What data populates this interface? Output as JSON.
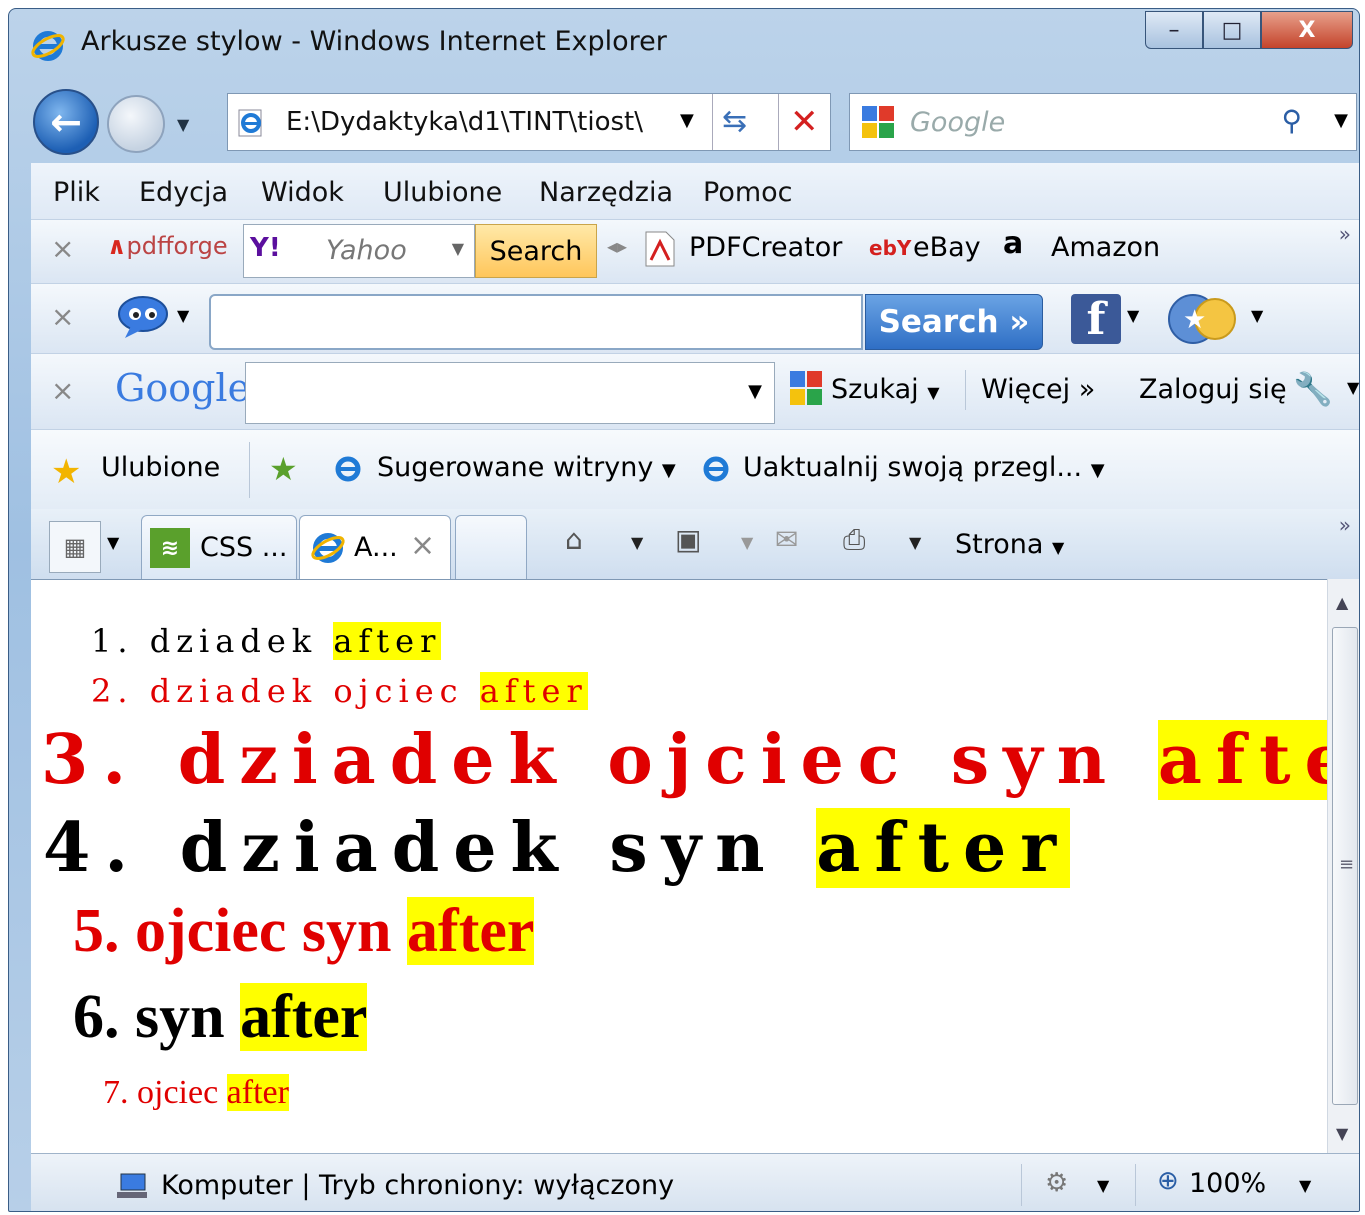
{
  "window": {
    "title": "Arkusze stylow - Windows Internet Explorer"
  },
  "caption_buttons": {
    "minimize": "–",
    "maximize": "□",
    "close": "X"
  },
  "address_bar": {
    "value": "E:\\Dydaktyka\\d1\\TINT\\tiost\\"
  },
  "search_box": {
    "placeholder": "Google"
  },
  "menu": [
    "Plik",
    "Edycja",
    "Widok",
    "Ulubione",
    "Narzędzia",
    "Pomoc"
  ],
  "toolbar1": {
    "pdfforge": "pdfforge",
    "yahoo_logo": "Y!",
    "yahoo_text": "Yahoo",
    "search_button": "Search",
    "pdfcreator": "PDFCreator",
    "ebay_icon": "ebY",
    "ebay": "eBay",
    "amazon_icon": "a",
    "amazon": "Amazon",
    "overflow": "»"
  },
  "toolbar2": {
    "search_button": "Search »",
    "facebook_icon": "f"
  },
  "toolbar3": {
    "google_logo": "Google",
    "szukaj": "Szukaj",
    "wiecej": "Więcej »",
    "zaloguj": "Zaloguj się"
  },
  "favorites_bar": {
    "ulubione": "Ulubione",
    "suggested": "Sugerowane witryny",
    "update": "Uaktualnij swoją przegl..."
  },
  "tabs": {
    "tab1": "CSS ...",
    "tab2": "A...",
    "close": "×",
    "strona": "Strona",
    "overflow": "»"
  },
  "content": {
    "lines": [
      {
        "num": "1.",
        "text": "dziadek",
        "after": "after"
      },
      {
        "num": "2.",
        "text": "dziadek ojciec",
        "after": "after"
      },
      {
        "num": "3.",
        "text": "dziadek ojciec syn",
        "after": "after"
      },
      {
        "num": "4.",
        "text": "dziadek syn",
        "after": "after"
      },
      {
        "num": "5.",
        "text": "ojciec syn",
        "after": "after"
      },
      {
        "num": "6.",
        "text": "syn",
        "after": "after"
      },
      {
        "num": "7.",
        "text": "ojciec",
        "after": "after"
      }
    ]
  },
  "statusbar": {
    "text": "Komputer | Tryb chroniony: wyłączony",
    "zoom": "100%"
  },
  "colors": {
    "highlight": "#ffff00",
    "red_text": "#e00000",
    "accent": "#2b5ea5"
  },
  "icons": [
    "ie-icon",
    "back-arrow-icon",
    "forward-arrow-icon",
    "refresh-icon",
    "stop-icon",
    "google-icon",
    "magnifier-icon",
    "pdfforge-icon",
    "yahoo-icon",
    "pdf-icon",
    "ebay-icon",
    "amazon-icon",
    "speech-bubble-icon",
    "facebook-icon",
    "star-icon",
    "wrench-icon",
    "add-favorite-icon",
    "quick-tabs-icon",
    "home-icon",
    "rss-icon",
    "mail-icon",
    "printer-icon",
    "computer-icon",
    "protected-mode-icon",
    "zoom-icon"
  ]
}
